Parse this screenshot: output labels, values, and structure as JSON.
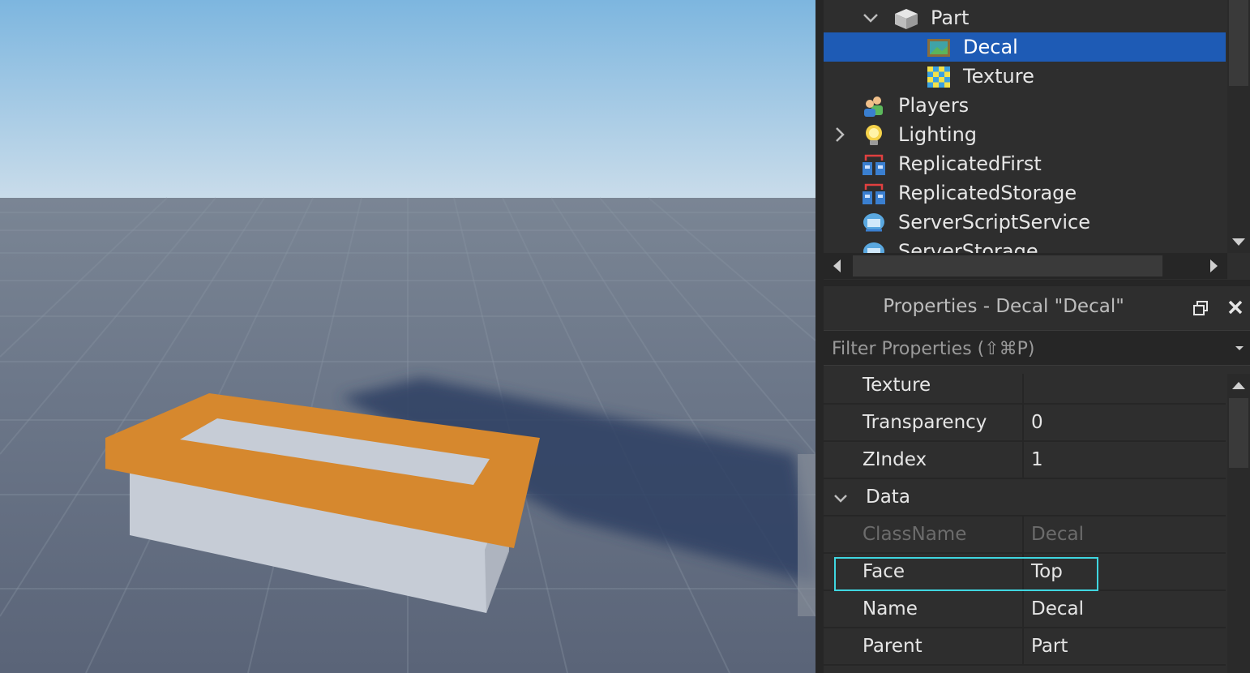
{
  "explorer": {
    "items": [
      {
        "label": "Part",
        "icon": "part-icon",
        "chevron": "down"
      },
      {
        "label": "Decal",
        "icon": "decal-icon",
        "selected": true
      },
      {
        "label": "Texture",
        "icon": "texture-icon"
      },
      {
        "label": "Players",
        "icon": "players-icon"
      },
      {
        "label": "Lighting",
        "icon": "lighting-icon",
        "chevron": "right"
      },
      {
        "label": "ReplicatedFirst",
        "icon": "replicated-first-icon"
      },
      {
        "label": "ReplicatedStorage",
        "icon": "replicated-storage-icon"
      },
      {
        "label": "ServerScriptService",
        "icon": "server-script-service-icon"
      },
      {
        "label": "ServerStorage",
        "icon": "server-storage-icon"
      }
    ]
  },
  "properties": {
    "title": "Properties - Decal \"Decal\"",
    "filter_placeholder": "Filter Properties (⇧⌘P)",
    "rows": [
      {
        "name": "Texture",
        "value": ""
      },
      {
        "name": "Transparency",
        "value": "0"
      },
      {
        "name": "ZIndex",
        "value": "1"
      },
      {
        "category": "Data"
      },
      {
        "name": "ClassName",
        "value": "Decal",
        "disabled": true
      },
      {
        "name": "Face",
        "value": "Top",
        "highlighted": true
      },
      {
        "name": "Name",
        "value": "Decal"
      },
      {
        "name": "Parent",
        "value": "Part"
      }
    ]
  },
  "colors": {
    "selection": "#1e5bb5",
    "highlight_outline": "#3fd6e0",
    "part_orange": "#d6882e",
    "panel_bg": "#2e2e2e"
  }
}
